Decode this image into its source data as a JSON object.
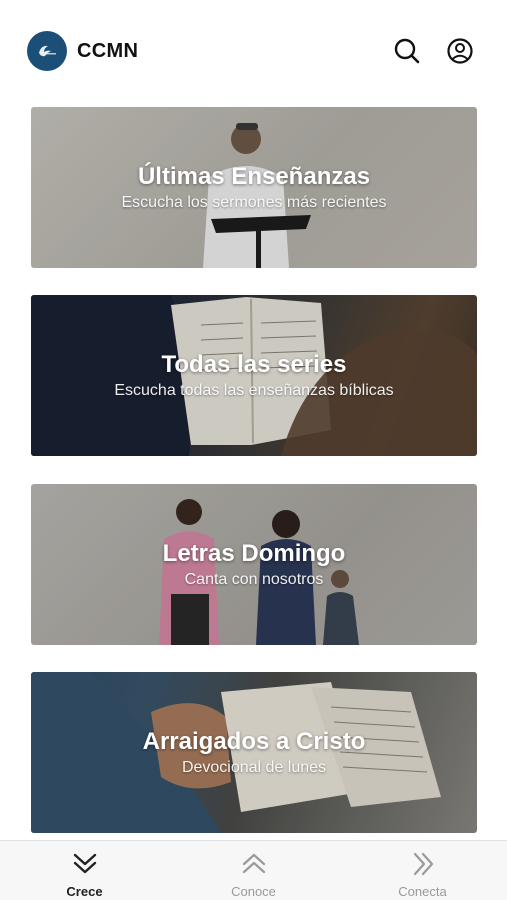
{
  "header": {
    "app_title": "CCMN",
    "logo_icon": "ccmn-logo",
    "search_icon": "search-icon",
    "account_icon": "account-circle-icon",
    "brand_color": "#1c4f77"
  },
  "cards": [
    {
      "title": "Últimas Enseñanzas",
      "subtitle": "Escucha los sermones más recientes",
      "image": "preacher-at-podium-photo"
    },
    {
      "title": "Todas las series",
      "subtitle": "Escucha todas las enseñanzas bíblicas",
      "image": "open-bible-photo"
    },
    {
      "title": "Letras Domingo",
      "subtitle": "Canta con nosotros",
      "image": "worship-singers-photo"
    },
    {
      "title": "Arraigados a Cristo",
      "subtitle": "Devocional de lunes",
      "image": "bible-study-notebook-photo"
    }
  ],
  "tabbar": {
    "tabs": [
      {
        "label": "Crece",
        "icon": "double-chevron-down-icon",
        "active": true
      },
      {
        "label": "Conoce",
        "icon": "double-chevron-up-icon",
        "active": false
      },
      {
        "label": "Conecta",
        "icon": "double-chevron-right-icon",
        "active": false
      }
    ],
    "active_color": "#222222",
    "inactive_color": "#9a9a9a"
  }
}
